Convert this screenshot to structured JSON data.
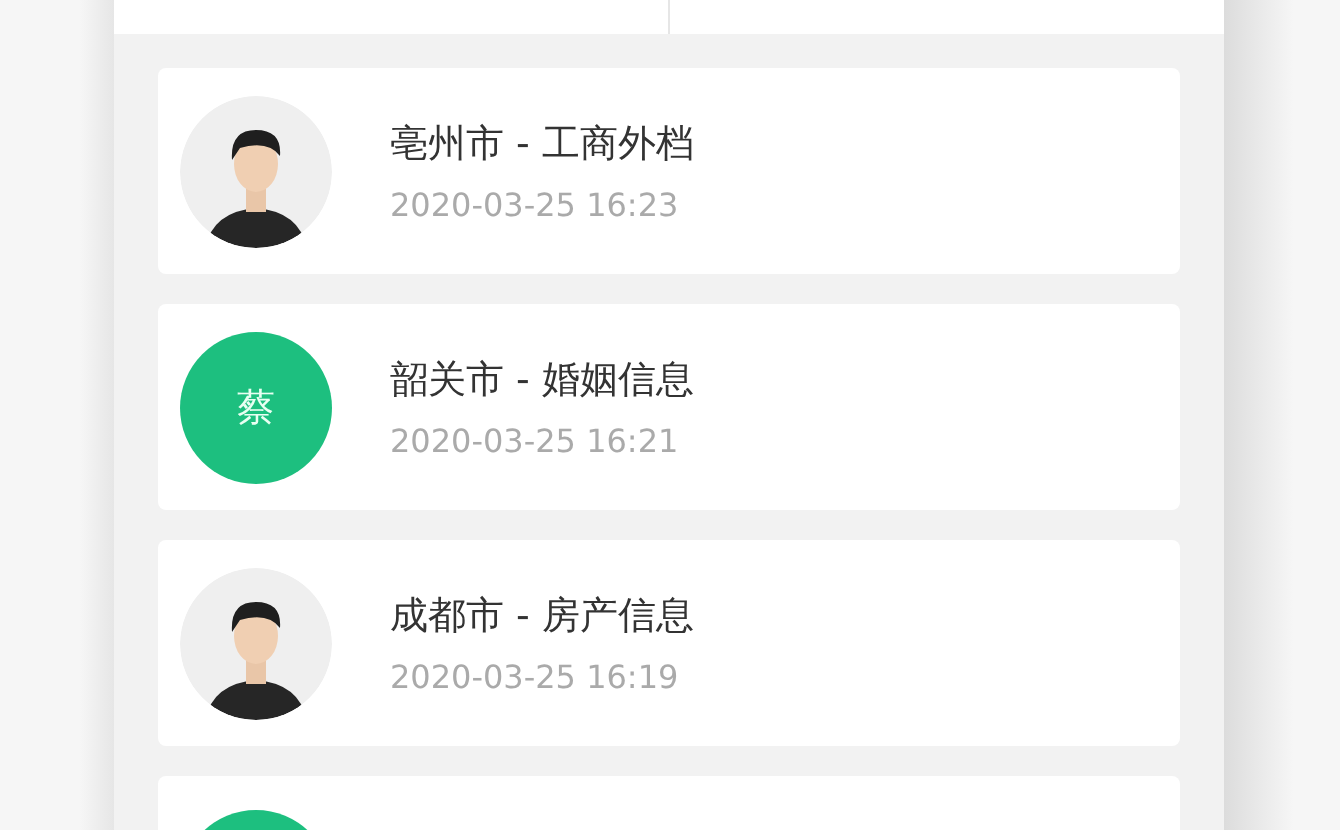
{
  "records": [
    {
      "title": "亳州市 - 工商外档",
      "time": "2020-03-25 16:23"
    },
    {
      "kind": "initial",
      "initial": "蔡",
      "color": "#1dbf7f",
      "title": "韶关市 - 婚姻信息",
      "time": "2020-03-25 16:21"
    },
    {
      "title": "成都市 - 房产信息",
      "time": "2020-03-25 16:19"
    },
    {
      "kind": "initial",
      "color": "#1dbf7f"
    }
  ]
}
